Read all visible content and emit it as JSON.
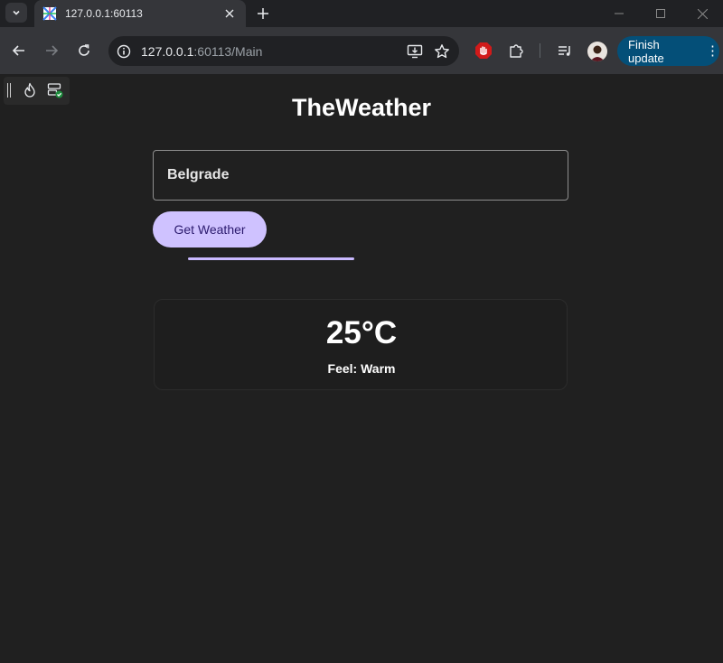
{
  "browser": {
    "tab_title": "127.0.0.1:60113",
    "url_host": "127.0.0.1",
    "url_rest": ":60113/Main",
    "finish_update_label": "Finish update"
  },
  "page": {
    "title": "TheWeather",
    "city_value": "Belgrade",
    "button_label": "Get Weather",
    "progress_fraction": 0.4,
    "temperature": "25°C",
    "feel_label": "Feel:",
    "feel_value": "Warm"
  },
  "colors": {
    "accent": "#cfc2ff",
    "update_button": "#044f78",
    "page_bg": "#202020"
  },
  "icons": [
    "tab-search-icon",
    "close-icon",
    "plus-icon",
    "minimize-icon",
    "maximize-icon",
    "window-close-icon",
    "back-icon",
    "forward-icon",
    "reload-icon",
    "info-icon",
    "install-icon",
    "star-icon",
    "adblock-icon",
    "puzzle-icon",
    "media-queue-icon",
    "more-vert-icon",
    "flame-icon",
    "storage-check-icon"
  ]
}
